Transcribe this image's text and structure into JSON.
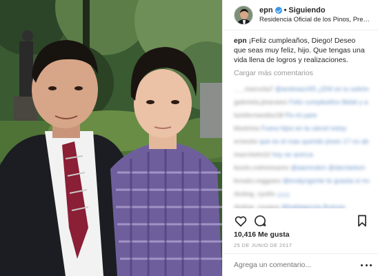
{
  "post": {
    "username": "epn",
    "separator": "•",
    "follow_status": "Siguiendo",
    "location": "Residencia Oficial de los Pinos, Preside..."
  },
  "caption": {
    "username": "epn",
    "text": "¡Feliz cumpleaños, Diego! Deseo que seas muy feliz, hijo. Que tengas una vida llena de logros y realizaciones."
  },
  "load_more_label": "Cargar más comentarios",
  "blurred_comments": [
    {
      "user": "___marcela7",
      "text": "@andreazv55 ¿ENI es tu sobrino? ¿¿¿¿¿¿"
    },
    {
      "user": "gabriela.jmaramz",
      "text": "Feliz cumpleaños Bebé y a mi chico lindo es muy apuesto"
    },
    {
      "user": "luisfernandez18",
      "text": "Pa mi pare"
    },
    {
      "user": "kkotrina",
      "text": "Fuera hijos en la cárcel estoy"
    },
    {
      "user": "ernesto",
      "text": "que es el mas querido jóven 17 no abraza a un 17"
    },
    {
      "user": "marchelo12",
      "text": "hoy se acerca"
    },
    {
      "user": "kevin.colmenares",
      "text": "@aaronskm @darzlarkon"
    },
    {
      "user": "kreato.reggaeo",
      "text": "@evalyngonte te guasta si me mandas a mi"
    },
    {
      "user": "dodog_ryulis",
      "text": "¡¡¡¡¡¡"
    },
    {
      "user": "dodog_ryugoa",
      "text": "@kaldagorsia Buenas"
    }
  ],
  "actions": {
    "like_icon": "heart-icon",
    "comment_icon": "comment-bubble-icon",
    "save_icon": "bookmark-icon"
  },
  "likes_text": "10,416 Me gusta",
  "date_text": "25 DE JUNIO DE 2017",
  "comment_input": {
    "placeholder": "Agrega un comentario...",
    "more_icon": "more-options-icon"
  }
}
